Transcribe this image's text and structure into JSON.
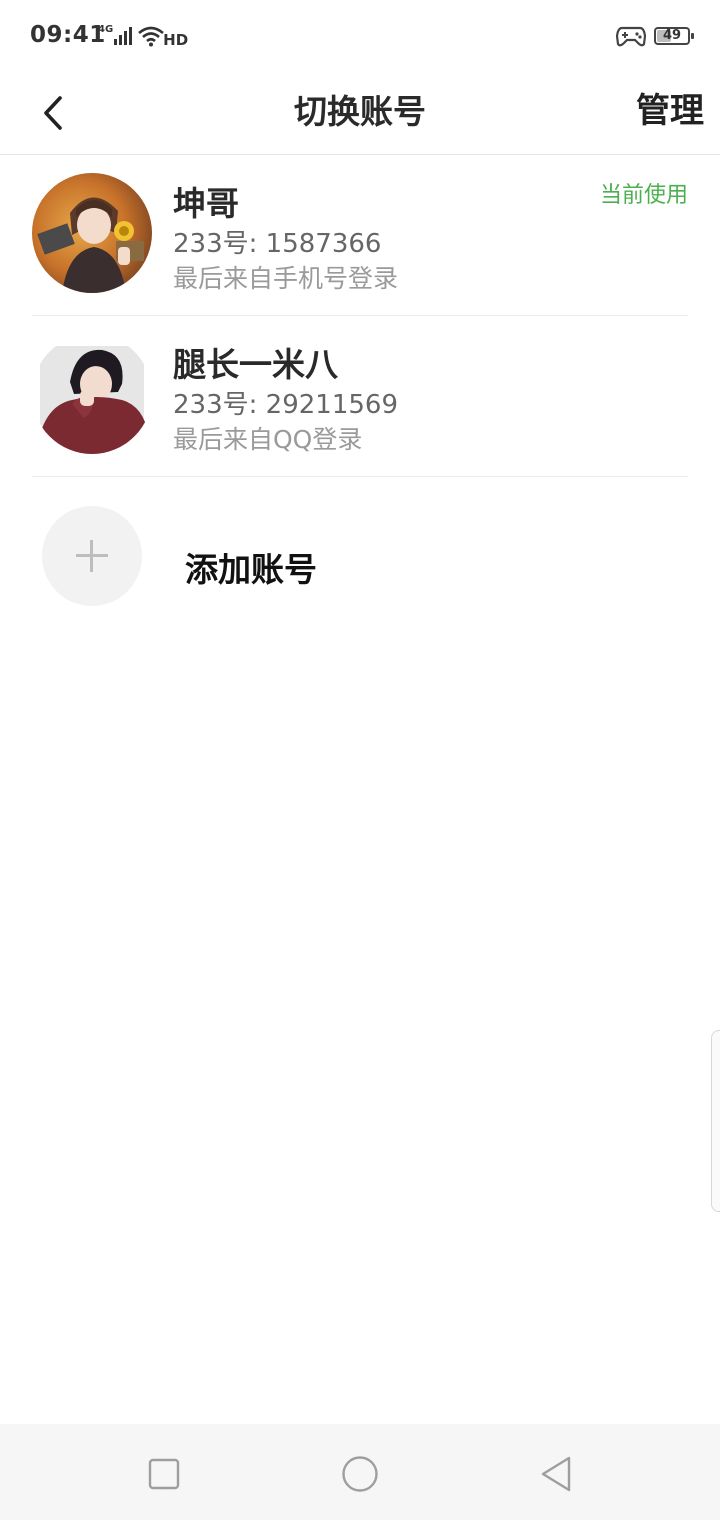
{
  "status_bar": {
    "time": "09:41",
    "network": "4G",
    "hd": "HD",
    "battery": "49",
    "battery_level_percent": 49,
    "icons": [
      "signal-icon",
      "wifi-icon",
      "game-controller-icon",
      "battery-icon"
    ]
  },
  "nav": {
    "title": "切换账号",
    "manage_label": "管理",
    "back_icon": "back-arrow-icon"
  },
  "accounts": [
    {
      "name": "坤哥",
      "id_text": "233号: 1587366",
      "source_text": "最后来自手机号登录",
      "badge": "当前使用"
    },
    {
      "name": "腿长一米八",
      "id_text": "233号: 29211569",
      "source_text": "最后来自QQ登录"
    }
  ],
  "add_account": {
    "label": "添加账号",
    "icon": "plus-icon"
  },
  "colors": {
    "accent_green": "#4caf50",
    "text_primary": "#2a2a2a",
    "text_secondary": "#666666",
    "text_tertiary": "#9a9a9a"
  },
  "system_nav": {
    "icons": [
      "recents-square-icon",
      "home-circle-icon",
      "back-triangle-icon"
    ]
  }
}
